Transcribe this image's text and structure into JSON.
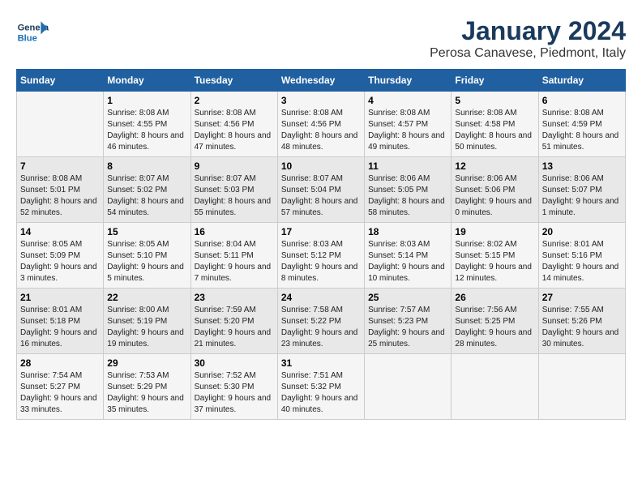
{
  "header": {
    "logo_line1": "General",
    "logo_line2": "Blue",
    "title": "January 2024",
    "subtitle": "Perosa Canavese, Piedmont, Italy"
  },
  "days_of_week": [
    "Sunday",
    "Monday",
    "Tuesday",
    "Wednesday",
    "Thursday",
    "Friday",
    "Saturday"
  ],
  "weeks": [
    [
      {
        "day": "",
        "sunrise": "",
        "sunset": "",
        "daylight": ""
      },
      {
        "day": "1",
        "sunrise": "Sunrise: 8:08 AM",
        "sunset": "Sunset: 4:55 PM",
        "daylight": "Daylight: 8 hours and 46 minutes."
      },
      {
        "day": "2",
        "sunrise": "Sunrise: 8:08 AM",
        "sunset": "Sunset: 4:56 PM",
        "daylight": "Daylight: 8 hours and 47 minutes."
      },
      {
        "day": "3",
        "sunrise": "Sunrise: 8:08 AM",
        "sunset": "Sunset: 4:56 PM",
        "daylight": "Daylight: 8 hours and 48 minutes."
      },
      {
        "day": "4",
        "sunrise": "Sunrise: 8:08 AM",
        "sunset": "Sunset: 4:57 PM",
        "daylight": "Daylight: 8 hours and 49 minutes."
      },
      {
        "day": "5",
        "sunrise": "Sunrise: 8:08 AM",
        "sunset": "Sunset: 4:58 PM",
        "daylight": "Daylight: 8 hours and 50 minutes."
      },
      {
        "day": "6",
        "sunrise": "Sunrise: 8:08 AM",
        "sunset": "Sunset: 4:59 PM",
        "daylight": "Daylight: 8 hours and 51 minutes."
      }
    ],
    [
      {
        "day": "7",
        "sunrise": "Sunrise: 8:08 AM",
        "sunset": "Sunset: 5:01 PM",
        "daylight": "Daylight: 8 hours and 52 minutes."
      },
      {
        "day": "8",
        "sunrise": "Sunrise: 8:07 AM",
        "sunset": "Sunset: 5:02 PM",
        "daylight": "Daylight: 8 hours and 54 minutes."
      },
      {
        "day": "9",
        "sunrise": "Sunrise: 8:07 AM",
        "sunset": "Sunset: 5:03 PM",
        "daylight": "Daylight: 8 hours and 55 minutes."
      },
      {
        "day": "10",
        "sunrise": "Sunrise: 8:07 AM",
        "sunset": "Sunset: 5:04 PM",
        "daylight": "Daylight: 8 hours and 57 minutes."
      },
      {
        "day": "11",
        "sunrise": "Sunrise: 8:06 AM",
        "sunset": "Sunset: 5:05 PM",
        "daylight": "Daylight: 8 hours and 58 minutes."
      },
      {
        "day": "12",
        "sunrise": "Sunrise: 8:06 AM",
        "sunset": "Sunset: 5:06 PM",
        "daylight": "Daylight: 9 hours and 0 minutes."
      },
      {
        "day": "13",
        "sunrise": "Sunrise: 8:06 AM",
        "sunset": "Sunset: 5:07 PM",
        "daylight": "Daylight: 9 hours and 1 minute."
      }
    ],
    [
      {
        "day": "14",
        "sunrise": "Sunrise: 8:05 AM",
        "sunset": "Sunset: 5:09 PM",
        "daylight": "Daylight: 9 hours and 3 minutes."
      },
      {
        "day": "15",
        "sunrise": "Sunrise: 8:05 AM",
        "sunset": "Sunset: 5:10 PM",
        "daylight": "Daylight: 9 hours and 5 minutes."
      },
      {
        "day": "16",
        "sunrise": "Sunrise: 8:04 AM",
        "sunset": "Sunset: 5:11 PM",
        "daylight": "Daylight: 9 hours and 7 minutes."
      },
      {
        "day": "17",
        "sunrise": "Sunrise: 8:03 AM",
        "sunset": "Sunset: 5:12 PM",
        "daylight": "Daylight: 9 hours and 8 minutes."
      },
      {
        "day": "18",
        "sunrise": "Sunrise: 8:03 AM",
        "sunset": "Sunset: 5:14 PM",
        "daylight": "Daylight: 9 hours and 10 minutes."
      },
      {
        "day": "19",
        "sunrise": "Sunrise: 8:02 AM",
        "sunset": "Sunset: 5:15 PM",
        "daylight": "Daylight: 9 hours and 12 minutes."
      },
      {
        "day": "20",
        "sunrise": "Sunrise: 8:01 AM",
        "sunset": "Sunset: 5:16 PM",
        "daylight": "Daylight: 9 hours and 14 minutes."
      }
    ],
    [
      {
        "day": "21",
        "sunrise": "Sunrise: 8:01 AM",
        "sunset": "Sunset: 5:18 PM",
        "daylight": "Daylight: 9 hours and 16 minutes."
      },
      {
        "day": "22",
        "sunrise": "Sunrise: 8:00 AM",
        "sunset": "Sunset: 5:19 PM",
        "daylight": "Daylight: 9 hours and 19 minutes."
      },
      {
        "day": "23",
        "sunrise": "Sunrise: 7:59 AM",
        "sunset": "Sunset: 5:20 PM",
        "daylight": "Daylight: 9 hours and 21 minutes."
      },
      {
        "day": "24",
        "sunrise": "Sunrise: 7:58 AM",
        "sunset": "Sunset: 5:22 PM",
        "daylight": "Daylight: 9 hours and 23 minutes."
      },
      {
        "day": "25",
        "sunrise": "Sunrise: 7:57 AM",
        "sunset": "Sunset: 5:23 PM",
        "daylight": "Daylight: 9 hours and 25 minutes."
      },
      {
        "day": "26",
        "sunrise": "Sunrise: 7:56 AM",
        "sunset": "Sunset: 5:25 PM",
        "daylight": "Daylight: 9 hours and 28 minutes."
      },
      {
        "day": "27",
        "sunrise": "Sunrise: 7:55 AM",
        "sunset": "Sunset: 5:26 PM",
        "daylight": "Daylight: 9 hours and 30 minutes."
      }
    ],
    [
      {
        "day": "28",
        "sunrise": "Sunrise: 7:54 AM",
        "sunset": "Sunset: 5:27 PM",
        "daylight": "Daylight: 9 hours and 33 minutes."
      },
      {
        "day": "29",
        "sunrise": "Sunrise: 7:53 AM",
        "sunset": "Sunset: 5:29 PM",
        "daylight": "Daylight: 9 hours and 35 minutes."
      },
      {
        "day": "30",
        "sunrise": "Sunrise: 7:52 AM",
        "sunset": "Sunset: 5:30 PM",
        "daylight": "Daylight: 9 hours and 37 minutes."
      },
      {
        "day": "31",
        "sunrise": "Sunrise: 7:51 AM",
        "sunset": "Sunset: 5:32 PM",
        "daylight": "Daylight: 9 hours and 40 minutes."
      },
      {
        "day": "",
        "sunrise": "",
        "sunset": "",
        "daylight": ""
      },
      {
        "day": "",
        "sunrise": "",
        "sunset": "",
        "daylight": ""
      },
      {
        "day": "",
        "sunrise": "",
        "sunset": "",
        "daylight": ""
      }
    ]
  ]
}
